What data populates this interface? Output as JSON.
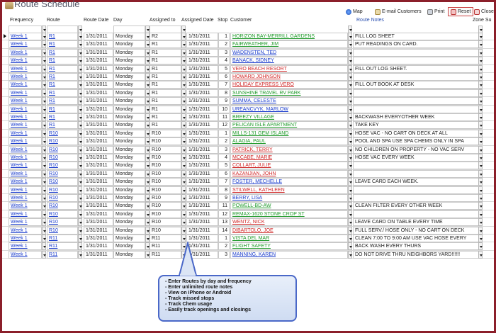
{
  "app": {
    "title": "Route Schedule"
  },
  "toolbar": {
    "map": "Map",
    "email": "E-mail Customers",
    "print": "Print",
    "reset": "Reset",
    "close": "Close"
  },
  "columns": {
    "frequency": "Frequency",
    "route": "Route",
    "route_date": "Route Date",
    "day": "Day",
    "assigned_to": "Assigned to",
    "assigned_date": "Assigned Date",
    "stop": "Stop",
    "customer": "Customer",
    "route_notes": "Route Notes",
    "zone": "Zone Su"
  },
  "rows": [
    {
      "freq": "Week 1",
      "route": "R1",
      "date": "1/31/2011",
      "day": "Monday",
      "assigned": "R2",
      "adate": "1/31/2011",
      "stop": "1",
      "customer": "HORIZON BAY-MERRILL GARDENS",
      "ccolor": "green",
      "note": "FILL LOG SHEET"
    },
    {
      "freq": "Week 1",
      "route": "R1",
      "date": "1/31/2011",
      "day": "Monday",
      "assigned": "R1",
      "adate": "1/31/2011",
      "stop": "2",
      "customer": "FAIRWEATHER, JIM",
      "ccolor": "green",
      "note": "PUT READINGS ON CARD."
    },
    {
      "freq": "Week 1",
      "route": "R1",
      "date": "1/31/2011",
      "day": "Monday",
      "assigned": "R1",
      "adate": "1/31/2011",
      "stop": "3",
      "customer": "WADENSTEN, TED",
      "ccolor": "blue",
      "note": ""
    },
    {
      "freq": "Week 1",
      "route": "R1",
      "date": "1/31/2011",
      "day": "Monday",
      "assigned": "R1",
      "adate": "1/31/2011",
      "stop": "4",
      "customer": "BANACK, SIDNEY",
      "ccolor": "blue",
      "note": ""
    },
    {
      "freq": "Week 1",
      "route": "R1",
      "date": "1/31/2011",
      "day": "Monday",
      "assigned": "R1",
      "adate": "1/31/2011",
      "stop": "5",
      "customer": "VERO BEACH RESORT",
      "ccolor": "red",
      "note": "FILL OUT LOG SHEET."
    },
    {
      "freq": "Week 1",
      "route": "R1",
      "date": "1/31/2011",
      "day": "Monday",
      "assigned": "R1",
      "adate": "1/31/2011",
      "stop": "6",
      "customer": "HOWARD JOHNSON",
      "ccolor": "red",
      "note": ""
    },
    {
      "freq": "Week 1",
      "route": "R1",
      "date": "1/31/2011",
      "day": "Monday",
      "assigned": "R1",
      "adate": "1/31/2011",
      "stop": "7",
      "customer": "HOLIDAY EXPRESS VERO",
      "ccolor": "red",
      "note": "FILL OUT BOOK AT DESK"
    },
    {
      "freq": "Week 1",
      "route": "R1",
      "date": "1/31/2011",
      "day": "Monday",
      "assigned": "R1",
      "adate": "1/31/2011",
      "stop": "8",
      "customer": "SUNSHINE TRAVEL RV PARK",
      "ccolor": "green",
      "note": ""
    },
    {
      "freq": "Week 1",
      "route": "R1",
      "date": "1/31/2011",
      "day": "Monday",
      "assigned": "R1",
      "adate": "1/31/2011",
      "stop": "9",
      "customer": "SUMMA, CELESTE",
      "ccolor": "blue",
      "note": ""
    },
    {
      "freq": "Week 1",
      "route": "R1",
      "date": "1/31/2011",
      "day": "Monday",
      "assigned": "R1",
      "adate": "1/31/2011",
      "stop": "10",
      "customer": "UREANCVYK, MARLOW",
      "ccolor": "blue",
      "note": ""
    },
    {
      "freq": "Week 1",
      "route": "R1",
      "date": "1/31/2011",
      "day": "Monday",
      "assigned": "R1",
      "adate": "1/31/2011",
      "stop": "11",
      "customer": "BREEZY VILLAGE",
      "ccolor": "green",
      "note": "BACKWASH EVERYOTHER WEEK"
    },
    {
      "freq": "Week 1",
      "route": "R1",
      "date": "1/31/2011",
      "day": "Monday",
      "assigned": "R1",
      "adate": "1/31/2011",
      "stop": "12",
      "customer": "PELICAN ISLE APARTMENT",
      "ccolor": "green",
      "note": "TAKE KEY"
    },
    {
      "freq": "Week 1",
      "route": "R10",
      "date": "1/31/2011",
      "day": "Monday",
      "assigned": "R10",
      "adate": "1/31/2011",
      "stop": "1",
      "customer": "MILLS-131 GEM ISLAND",
      "ccolor": "green",
      "note": "HOSE VAC - NO CART ON DECK AT ALL"
    },
    {
      "freq": "Week 1",
      "route": "R10",
      "date": "1/31/2011",
      "day": "Monday",
      "assigned": "R10",
      "adate": "1/31/2011",
      "stop": "2",
      "customer": "ALAGIA, PAUL",
      "ccolor": "green",
      "note": "POOL AND SPA USE SPA CHEMS ONLY IN SPA"
    },
    {
      "freq": "Week 1",
      "route": "R10",
      "date": "1/31/2011",
      "day": "Monday",
      "assigned": "R10",
      "adate": "1/31/2011",
      "stop": "3",
      "customer": "PATRICK, TERRY",
      "ccolor": "red",
      "note": "NO CHILDREN ON PROPERTY - NO VAC SERV"
    },
    {
      "freq": "Week 1",
      "route": "R10",
      "date": "1/31/2011",
      "day": "Monday",
      "assigned": "R10",
      "adate": "1/31/2011",
      "stop": "4",
      "customer": "MCCABE, MARIE",
      "ccolor": "red",
      "note": "HOSE VAC EVERY WEEK"
    },
    {
      "freq": "Week 1",
      "route": "R10",
      "date": "1/31/2011",
      "day": "Monday",
      "assigned": "R10",
      "adate": "1/31/2011",
      "stop": "5",
      "customer": "COLLART, JULIE",
      "ccolor": "red",
      "note": ""
    },
    {
      "freq": "Week 1",
      "route": "R10",
      "date": "1/31/2011",
      "day": "Monday",
      "assigned": "R10",
      "adate": "1/31/2011",
      "stop": "6",
      "customer": "KAZANJIAN, JOHN",
      "ccolor": "red",
      "note": ""
    },
    {
      "freq": "Week 1",
      "route": "R10",
      "date": "1/31/2011",
      "day": "Monday",
      "assigned": "R10",
      "adate": "1/31/2011",
      "stop": "7",
      "customer": "FOSTER, MECHELLE",
      "ccolor": "blue",
      "note": "LEAVE CARD EACH WEEK."
    },
    {
      "freq": "Week 1",
      "route": "R10",
      "date": "1/31/2011",
      "day": "Monday",
      "assigned": "R10",
      "adate": "1/31/2011",
      "stop": "8",
      "customer": "STILWELL, KATHLEEN",
      "ccolor": "red",
      "note": ""
    },
    {
      "freq": "Week 1",
      "route": "R10",
      "date": "1/31/2011",
      "day": "Monday",
      "assigned": "R10",
      "adate": "1/31/2011",
      "stop": "9",
      "customer": "BERRY, LISA",
      "ccolor": "blue",
      "note": ""
    },
    {
      "freq": "Week 1",
      "route": "R10",
      "date": "1/31/2011",
      "day": "Monday",
      "assigned": "R10",
      "adate": "1/31/2011",
      "stop": "11",
      "customer": "POWELL-BD-AW",
      "ccolor": "green",
      "note": "CLEAN FILTER EVERY OTHER WEEK"
    },
    {
      "freq": "Week 1",
      "route": "R10",
      "date": "1/31/2011",
      "day": "Monday",
      "assigned": "R10",
      "adate": "1/31/2011",
      "stop": "12",
      "customer": "REMAX-1620 STONE CROP ST",
      "ccolor": "green",
      "note": ""
    },
    {
      "freq": "Week 1",
      "route": "R10",
      "date": "1/31/2011",
      "day": "Monday",
      "assigned": "R10",
      "adate": "1/31/2011",
      "stop": "13",
      "customer": "WENTZ, NICK",
      "ccolor": "red",
      "note": "LEAVE CARD ON TABLE EVERY TIME"
    },
    {
      "freq": "Week 1",
      "route": "R10",
      "date": "1/31/2011",
      "day": "Monday",
      "assigned": "R10",
      "adate": "1/31/2011",
      "stop": "14",
      "customer": "DIBARTOLO, JOE",
      "ccolor": "red",
      "note": "FULL SERV./ HOSE ONLY - NO CART ON DECK"
    },
    {
      "freq": "Week 1",
      "route": "R11",
      "date": "1/31/2011",
      "day": "Monday",
      "assigned": "R11",
      "adate": "1/31/2011",
      "stop": "1",
      "customer": "VISTA DEL MAR",
      "ccolor": "green",
      "note": "CLEAN 7:00 TO 9:00 AM USE VAC HOSE EVERY"
    },
    {
      "freq": "Week 1",
      "route": "R11",
      "date": "1/31/2011",
      "day": "Monday",
      "assigned": "R11",
      "adate": "1/31/2011",
      "stop": "2",
      "customer": "FLIGHT SAFETY",
      "ccolor": "green",
      "note": "BACK WASH EVERY THURS"
    },
    {
      "freq": "Week 1",
      "route": "R11",
      "date": "1/31/2011",
      "day": "Monday",
      "assigned": "R11",
      "adate": "1/31/2011",
      "stop": "3",
      "customer": "MANNING, KAREN",
      "ccolor": "blue",
      "note": "DO NOT DRIVE THRU NEIGHBORS YARD!!!!!!"
    }
  ],
  "callout": [
    "- Enter Routes by day and frequency",
    "- Enter unlimited route notes",
    "- View on iPhone or Android",
    "- Track missed stops",
    "- Track Chem usage",
    "- Easily track openings and closings"
  ],
  "colors": {
    "frame": "#8b1f2a",
    "green": "#1f9a2a",
    "red": "#d02828",
    "blue": "#1a3ccc"
  }
}
